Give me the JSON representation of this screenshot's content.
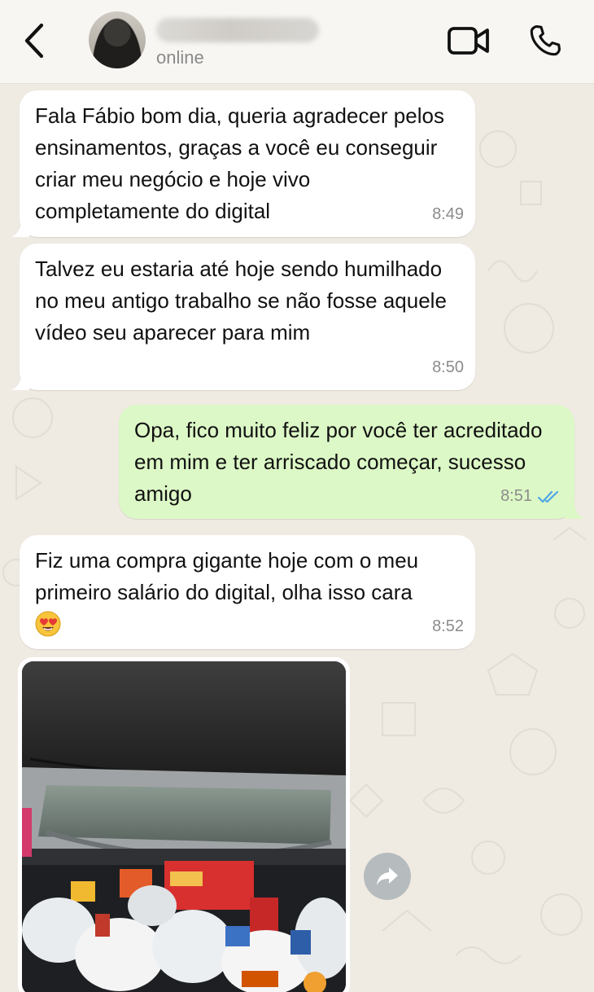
{
  "header": {
    "status": "online"
  },
  "messages": [
    {
      "direction": "incoming",
      "text": "Fala Fábio bom dia, queria agradecer pelos ensinamentos, graças a você eu conseguir criar meu negócio e hoje vivo completamente do digital",
      "time": "8:49"
    },
    {
      "direction": "incoming",
      "text": "Talvez eu estaria até hoje sendo humilhado no meu antigo trabalho se não fosse aquele vídeo seu aparecer para mim",
      "time": "8:50"
    },
    {
      "direction": "outgoing",
      "text": "Opa, fico muito feliz por você ter acreditado em mim e ter arriscado começar, sucesso amigo",
      "time": "8:51",
      "read": true
    },
    {
      "direction": "incoming",
      "text": "Fiz uma compra gigante hoje com o meu primeiro salário do digital, olha isso cara",
      "emoji": "heart-eyes",
      "time": "8:52"
    },
    {
      "direction": "incoming",
      "type": "photo"
    }
  ],
  "colors": {
    "incoming_bubble": "#ffffff",
    "outgoing_bubble": "#dcf8c6",
    "read_ticks": "#4fa6e8",
    "chat_background": "#efeae2"
  },
  "icons": [
    "back-icon",
    "video-call-icon",
    "voice-call-icon",
    "double-check-icon",
    "forward-icon",
    "heart-eyes-emoji"
  ]
}
